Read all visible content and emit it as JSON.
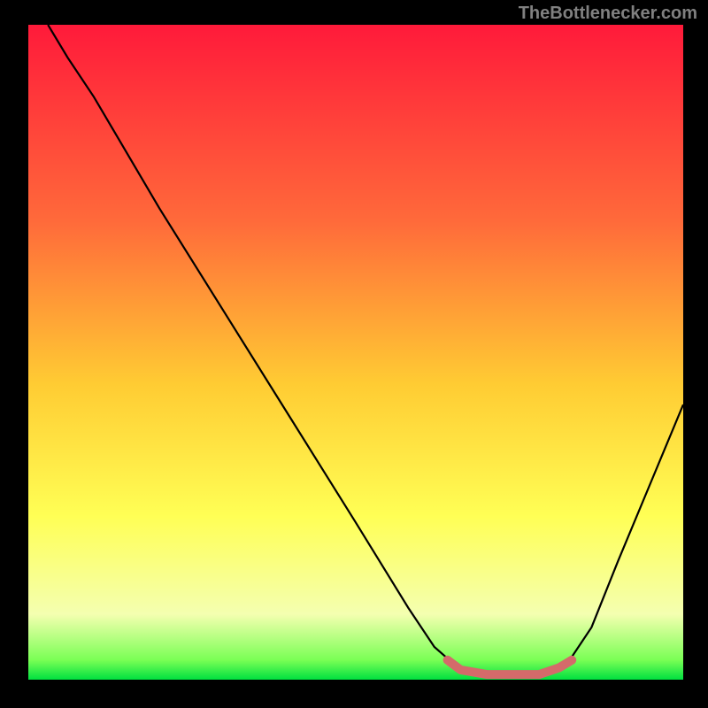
{
  "watermark": "TheBottlenecker.com",
  "chart_data": {
    "type": "line",
    "title": "",
    "xlabel": "",
    "ylabel": "",
    "xlim": [
      0,
      100
    ],
    "ylim": [
      0,
      100
    ],
    "background_gradient": {
      "stops": [
        {
          "offset": 0,
          "color": "#ff1a3a"
        },
        {
          "offset": 30,
          "color": "#ff6a3a"
        },
        {
          "offset": 55,
          "color": "#ffcc33"
        },
        {
          "offset": 75,
          "color": "#ffff55"
        },
        {
          "offset": 90,
          "color": "#f4ffb0"
        },
        {
          "offset": 97,
          "color": "#7aff55"
        },
        {
          "offset": 100,
          "color": "#00e040"
        }
      ]
    },
    "series": [
      {
        "name": "bottleneck-curve",
        "color": "#000000",
        "points": [
          {
            "x": 3,
            "y": 100
          },
          {
            "x": 6,
            "y": 95
          },
          {
            "x": 10,
            "y": 89
          },
          {
            "x": 20,
            "y": 72
          },
          {
            "x": 30,
            "y": 56
          },
          {
            "x": 40,
            "y": 40
          },
          {
            "x": 50,
            "y": 24
          },
          {
            "x": 58,
            "y": 11
          },
          {
            "x": 62,
            "y": 5
          },
          {
            "x": 66,
            "y": 1.5
          },
          {
            "x": 70,
            "y": 0.5
          },
          {
            "x": 74,
            "y": 0.5
          },
          {
            "x": 78,
            "y": 0.5
          },
          {
            "x": 82,
            "y": 2
          },
          {
            "x": 86,
            "y": 8
          },
          {
            "x": 90,
            "y": 18
          },
          {
            "x": 95,
            "y": 30
          },
          {
            "x": 100,
            "y": 42
          }
        ]
      },
      {
        "name": "optimal-marker",
        "color": "#d46a6a",
        "width": 10,
        "points": [
          {
            "x": 64,
            "y": 3
          },
          {
            "x": 66,
            "y": 1.5
          },
          {
            "x": 70,
            "y": 0.8
          },
          {
            "x": 74,
            "y": 0.8
          },
          {
            "x": 78,
            "y": 0.8
          },
          {
            "x": 81,
            "y": 1.8
          },
          {
            "x": 83,
            "y": 3
          }
        ]
      }
    ]
  }
}
